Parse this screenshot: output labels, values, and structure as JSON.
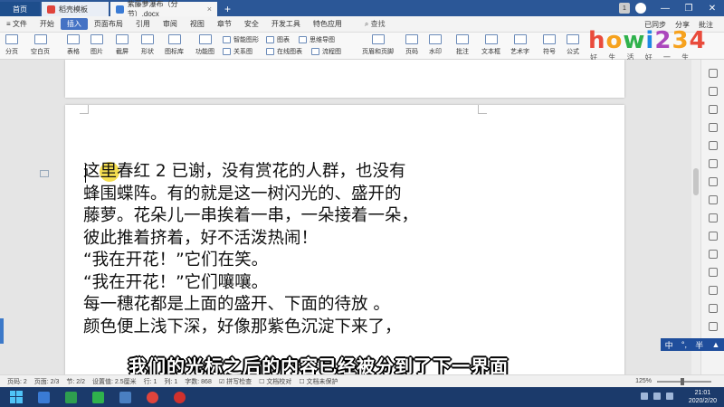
{
  "tabs": {
    "home": "首页",
    "template": "稻壳模板",
    "document": "紫藤萝瀑布（分节）.docx"
  },
  "menu": {
    "file": "文件",
    "items": [
      "开始",
      "插入",
      "页面布局",
      "引用",
      "审阅",
      "视图",
      "章节",
      "安全",
      "开发工具",
      "特色应用"
    ],
    "active_index": 1,
    "search": "查找",
    "sync": "已同步",
    "share": "分享",
    "comment": "批注"
  },
  "ribbon": {
    "big": [
      "分页",
      "空白页",
      "表格",
      "图片",
      "截屏",
      "形状",
      "图标库",
      "功能图",
      "页眉和页脚",
      "页码",
      "水印",
      "批注",
      "文本框",
      "艺术字",
      "符号",
      "公式"
    ],
    "small": [
      "智能图形",
      "图表",
      "思维导图",
      "关系图",
      "在线图表",
      "流程图"
    ]
  },
  "logo": {
    "text": "howi234",
    "colors": [
      "#e94b3c",
      "#f6a21e",
      "#2fb24c",
      "#1e88e5",
      "#ab47bc",
      "#f6a21e",
      "#e94b3c"
    ],
    "subtitle": "好 生 活 好 一 生"
  },
  "document": {
    "lines": [
      "这里春红 2 已谢，没有赏花的人群，也没有",
      "蜂围蝶阵。有的就是这一树闪光的、盛开的",
      "藤萝。花朵儿一串挨着一串，一朵接着一朵，",
      "彼此推着挤着，好不活泼热闹！",
      "“我在开花！”它们在笑。",
      "“我在开花！”它们嚷嚷。",
      "每一穗花都是上面的盛开、下面的待放  。",
      "颜色便上浅下深，好像那紫色沉淀下来了，"
    ]
  },
  "caption": "我们的光标之后的内容已经被分到了下一界面",
  "ime": {
    "mode": "中",
    "width": "半"
  },
  "status": {
    "page": "页码: 2",
    "pages": "页面: 2/3",
    "section": "节: 2/2",
    "setting": "设置值: 2.5厘米",
    "row": "行: 1",
    "col": "列: 1",
    "words": "字数: 868",
    "spell": "拼写检查",
    "proof": "文档校对",
    "protect": "文档未保护",
    "zoom": "125%"
  },
  "taskbar": {
    "time": "21:01",
    "date": "2020/2/20",
    "app_colors": [
      "#3a7bd5",
      "#2e9e4f",
      "#2fb24c",
      "#4a7fc1",
      "#e0443c",
      "#d0312d"
    ]
  }
}
